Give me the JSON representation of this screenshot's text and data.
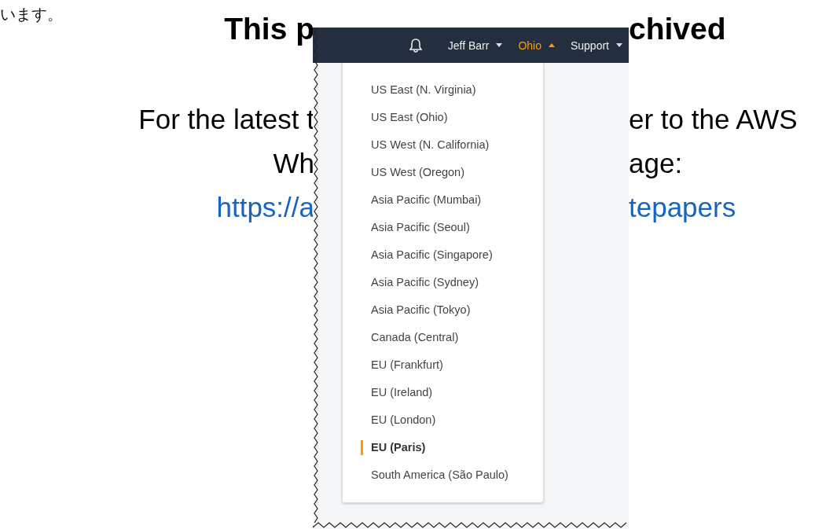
{
  "document": {
    "fragment_top": "います。",
    "banner": {
      "left": "This p",
      "right": "chived"
    },
    "lines": [
      {
        "kind": "text",
        "left": "For the latest t",
        "right": "er to the AWS"
      },
      {
        "kind": "text",
        "left": "Wh",
        "right": "age:"
      },
      {
        "kind": "link",
        "left": "https://a",
        "right": "tepapers"
      }
    ]
  },
  "screenshot": {
    "nav": [
      {
        "label": "Jeff Barr",
        "expanded": false
      },
      {
        "label": "Ohio",
        "expanded": true
      },
      {
        "label": "Support",
        "expanded": false
      }
    ],
    "regions": [
      {
        "label": "US East (N. Virginia)",
        "selected": false
      },
      {
        "label": "US East (Ohio)",
        "selected": false
      },
      {
        "label": "US West (N. California)",
        "selected": false
      },
      {
        "label": "US West (Oregon)",
        "selected": false
      },
      {
        "label": "Asia Pacific (Mumbai)",
        "selected": false
      },
      {
        "label": "Asia Pacific (Seoul)",
        "selected": false
      },
      {
        "label": "Asia Pacific (Singapore)",
        "selected": false
      },
      {
        "label": "Asia Pacific (Sydney)",
        "selected": false
      },
      {
        "label": "Asia Pacific (Tokyo)",
        "selected": false
      },
      {
        "label": "Canada (Central)",
        "selected": false
      },
      {
        "label": "EU (Frankfurt)",
        "selected": false
      },
      {
        "label": "EU (Ireland)",
        "selected": false
      },
      {
        "label": "EU (London)",
        "selected": false
      },
      {
        "label": "EU (Paris)",
        "selected": true
      },
      {
        "label": "South America (São Paulo)",
        "selected": false
      }
    ]
  }
}
